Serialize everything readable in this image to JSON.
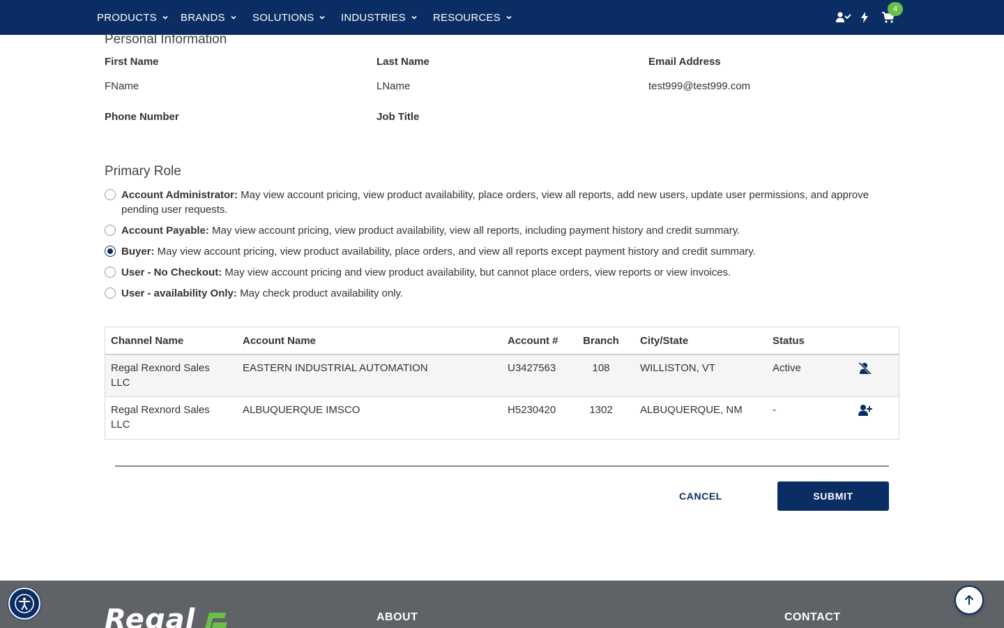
{
  "nav": {
    "items": [
      {
        "label": "PRODUCTS"
      },
      {
        "label": "BRANDS"
      },
      {
        "label": "SOLUTIONS"
      },
      {
        "label": "INDUSTRIES"
      },
      {
        "label": "RESOURCES"
      }
    ],
    "icons": [
      "user-check-icon",
      "bolt-icon",
      "cart-icon"
    ],
    "cart_count": "4",
    "background": "#0a2d63",
    "badge_color": "#6abf4b"
  },
  "personal": {
    "title": "Personal Information",
    "fields": {
      "first_name": {
        "label": "First Name",
        "value": "FName"
      },
      "last_name": {
        "label": "Last Name",
        "value": "LName"
      },
      "email": {
        "label": "Email Address",
        "value": "test999@test999.com"
      },
      "phone": {
        "label": "Phone Number",
        "value": ""
      },
      "job_title": {
        "label": "Job Title",
        "value": ""
      }
    }
  },
  "roles": {
    "title": "Primary Role",
    "selected": "Buyer",
    "options": [
      {
        "name": "Account Administrator:",
        "desc": " May view account pricing, view product availability, place orders, view all reports, add new users, update user permissions, and approve pending user requests.",
        "checked": false
      },
      {
        "name": "Account Payable:",
        "desc": " May view account pricing, view product availability, view all reports, including payment history and credit summary.",
        "checked": false
      },
      {
        "name": "Buyer:",
        "desc": " May view account pricing, view product availability, place orders, and view all reports except payment history and credit summary.",
        "checked": true
      },
      {
        "name": "User - No Checkout:",
        "desc": " May view account pricing and view product availability, but cannot place orders, view reports or view invoices.",
        "checked": false
      },
      {
        "name": "User - availability Only:",
        "desc": " May check product availability only.",
        "checked": false
      }
    ]
  },
  "accounts_table": {
    "headers": {
      "channel": "Channel Name",
      "account": "Account Name",
      "number": "Account #",
      "branch": "Branch",
      "city": "City/State",
      "status": "Status"
    },
    "rows": [
      {
        "channel": "Regal Rexnord Sales LLC",
        "account": "EASTERN INDUSTRIAL AUTOMATION",
        "number": "U3427563",
        "branch": "108",
        "city": "WILLISTON, VT",
        "status": "Active",
        "action_icon": "remove-user-icon"
      },
      {
        "channel": "Regal Rexnord Sales LLC",
        "account": "ALBUQUERQUE IMSCO",
        "number": "H5230420",
        "branch": "1302",
        "city": "ALBUQUERQUE, NM",
        "status": "-",
        "action_icon": "add-user-icon"
      }
    ]
  },
  "actions": {
    "cancel": "CANCEL",
    "submit": "SUBMIT"
  },
  "footer": {
    "logo_text": "Regal",
    "col_about": "ABOUT",
    "col_contact": "CONTACT",
    "background": "#5f6266",
    "logo_accent": "#6abf4b"
  }
}
